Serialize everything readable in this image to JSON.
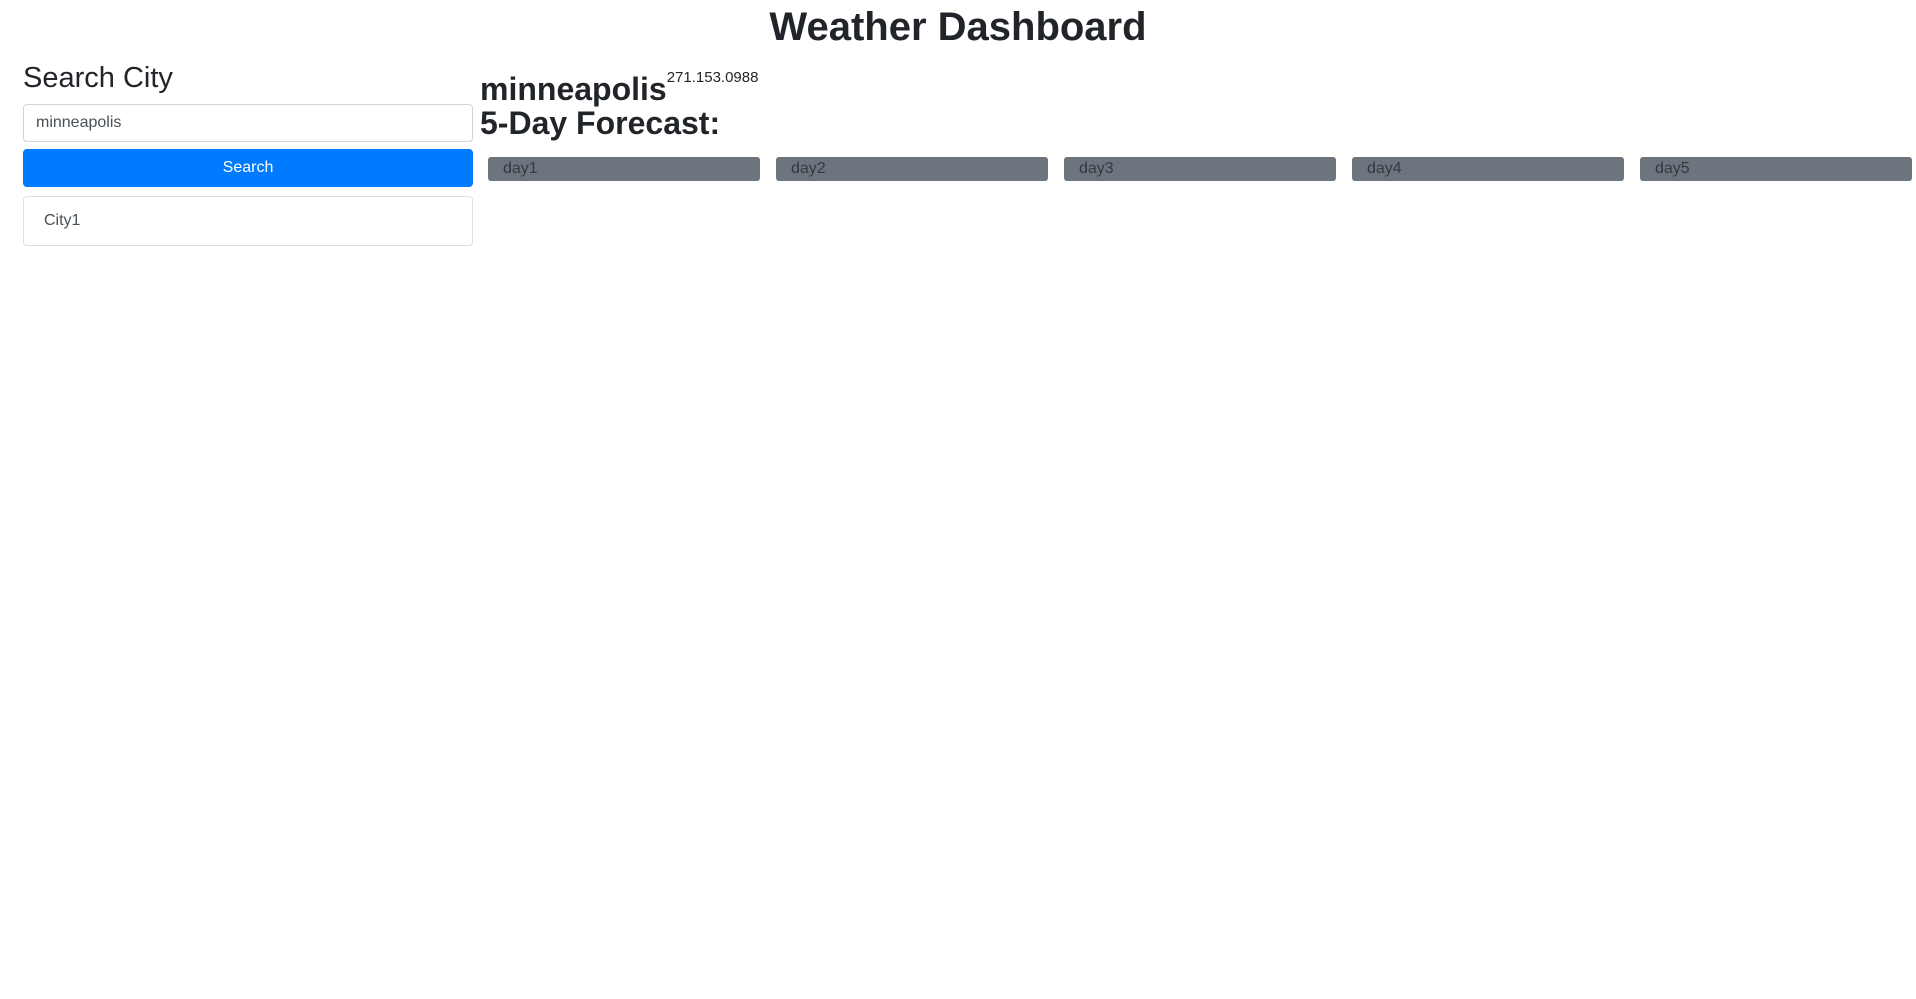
{
  "page": {
    "title": "Weather Dashboard"
  },
  "sidebar": {
    "heading": "Search City",
    "search_input_value": "minneapolis",
    "search_button_label": "Search",
    "cities": [
      "City1"
    ]
  },
  "main": {
    "city_name": "minneapolis",
    "city_coords": "271.153.0988",
    "forecast_heading": "5-Day Forecast:",
    "forecast_days": [
      "day1",
      "day2",
      "day3",
      "day4",
      "day5"
    ]
  },
  "colors": {
    "primary": "#007bff",
    "card_background": "#6c757d",
    "text": "#212529"
  }
}
